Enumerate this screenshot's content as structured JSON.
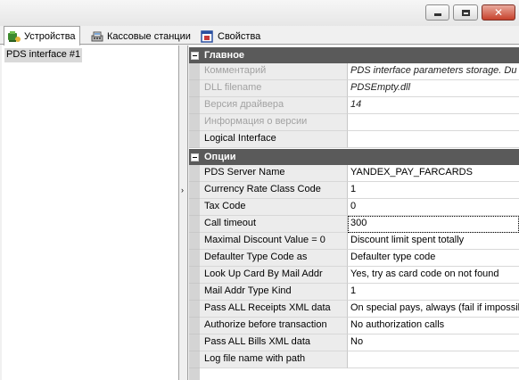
{
  "window": {
    "buttons": {
      "minimize_icon": "minimize-icon",
      "maximize_icon": "maximize-icon",
      "close_icon": "close-icon",
      "close_glyph": "✕"
    }
  },
  "tabs": [
    {
      "label": "Устройства",
      "icon": "devices-icon",
      "active": true
    },
    {
      "label": "Кассовые станции",
      "icon": "cash-stations-icon",
      "active": false
    },
    {
      "label": "Свойства",
      "icon": "properties-icon",
      "active": false
    }
  ],
  "tree": {
    "items": [
      {
        "label": "PDS interface #1",
        "selected": true
      }
    ]
  },
  "splitter": {
    "arrow": "›"
  },
  "property_grid": {
    "categories": [
      {
        "title": "Главное",
        "rows": [
          {
            "name": "Комментарий",
            "value": "PDS interface parameters storage. Du",
            "disabled": true,
            "italic": true
          },
          {
            "name": "DLL filename",
            "value": "PDSEmpty.dll",
            "disabled": true,
            "italic": true
          },
          {
            "name": "Версия драйвера",
            "value": "14",
            "disabled": true,
            "italic": true
          },
          {
            "name": "Информация о версии",
            "value": "",
            "disabled": true,
            "italic": false
          },
          {
            "name": "Logical Interface",
            "value": "",
            "disabled": false,
            "italic": false
          }
        ]
      },
      {
        "title": "Опции",
        "rows": [
          {
            "name": "PDS Server Name",
            "value": "YANDEX_PAY_FARCARDS",
            "disabled": false,
            "italic": false
          },
          {
            "name": "Currency Rate Class Code",
            "value": "1",
            "disabled": false,
            "italic": false
          },
          {
            "name": "Tax Code",
            "value": "0",
            "disabled": false,
            "italic": false
          },
          {
            "name": "Call timeout",
            "value": "300",
            "disabled": false,
            "italic": false,
            "selected": true
          },
          {
            "name": "Maximal Discount Value = 0",
            "value": "Discount limit spent totally",
            "disabled": false,
            "italic": false
          },
          {
            "name": "Defaulter Type Code as",
            "value": "Defaulter type code",
            "disabled": false,
            "italic": false
          },
          {
            "name": "Look Up Card By Mail Addr",
            "value": "Yes, try as card code on not found",
            "disabled": false,
            "italic": false
          },
          {
            "name": "Mail Addr Type Kind",
            "value": "1",
            "disabled": false,
            "italic": false
          },
          {
            "name": "Pass ALL Receipts XML data",
            "value": "On special pays, always (fail if impossil",
            "disabled": false,
            "italic": false
          },
          {
            "name": "Authorize before transaction",
            "value": "No authorization calls",
            "disabled": false,
            "italic": false
          },
          {
            "name": "Pass ALL Bills XML data",
            "value": "No",
            "disabled": false,
            "italic": false
          },
          {
            "name": "Log file name with path",
            "value": "",
            "disabled": false,
            "italic": false
          }
        ]
      }
    ]
  },
  "colors": {
    "category_header": "#5a5a5a",
    "name_column": "#ececec",
    "gutter": "#d4d4d4",
    "selection": "#d9d9d9"
  }
}
